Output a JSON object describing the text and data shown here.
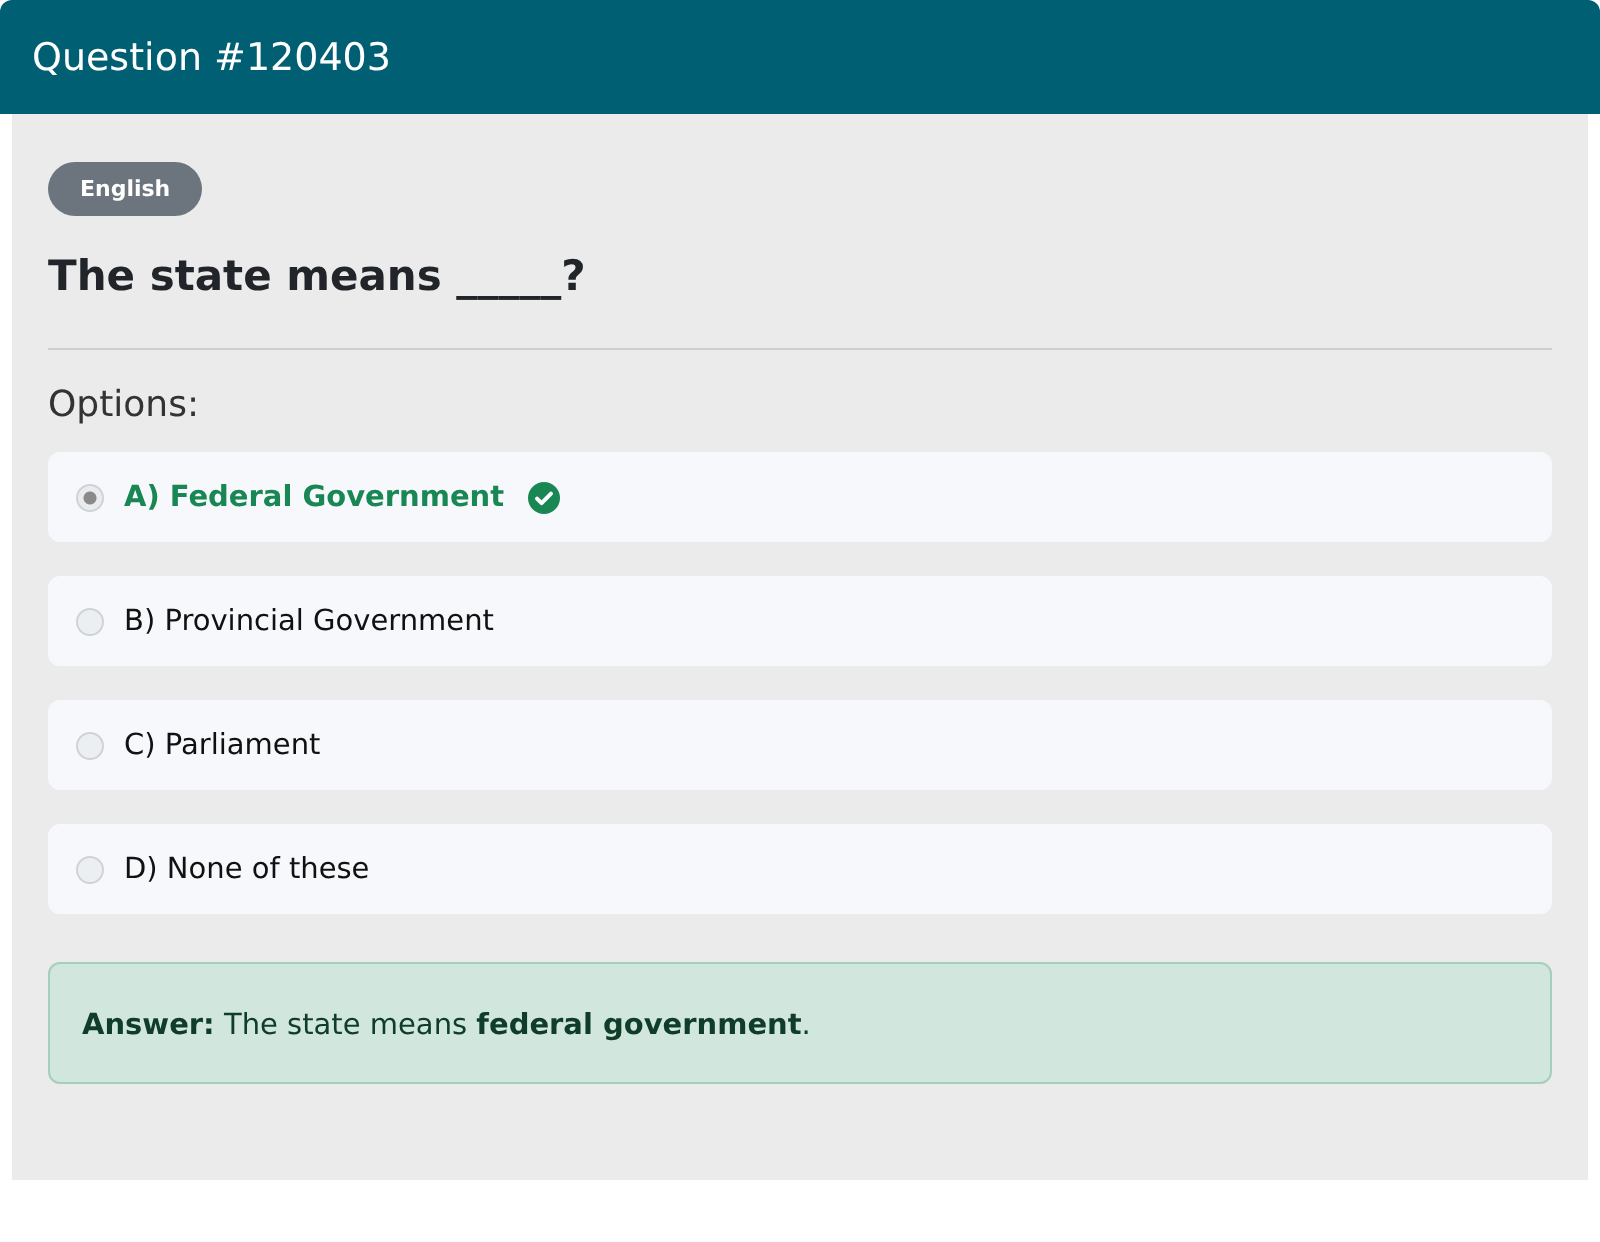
{
  "header": {
    "title": "Question #120403"
  },
  "badge": "English",
  "question": "The state means _____?",
  "options_label": "Options:",
  "options": [
    {
      "label": "A) Federal Government",
      "selected": true,
      "correct": true
    },
    {
      "label": "B) Provincial Government",
      "selected": false,
      "correct": false
    },
    {
      "label": "C) Parliament",
      "selected": false,
      "correct": false
    },
    {
      "label": "D) None of these",
      "selected": false,
      "correct": false
    }
  ],
  "answer": "**Answer:** The state means **federal government**."
}
